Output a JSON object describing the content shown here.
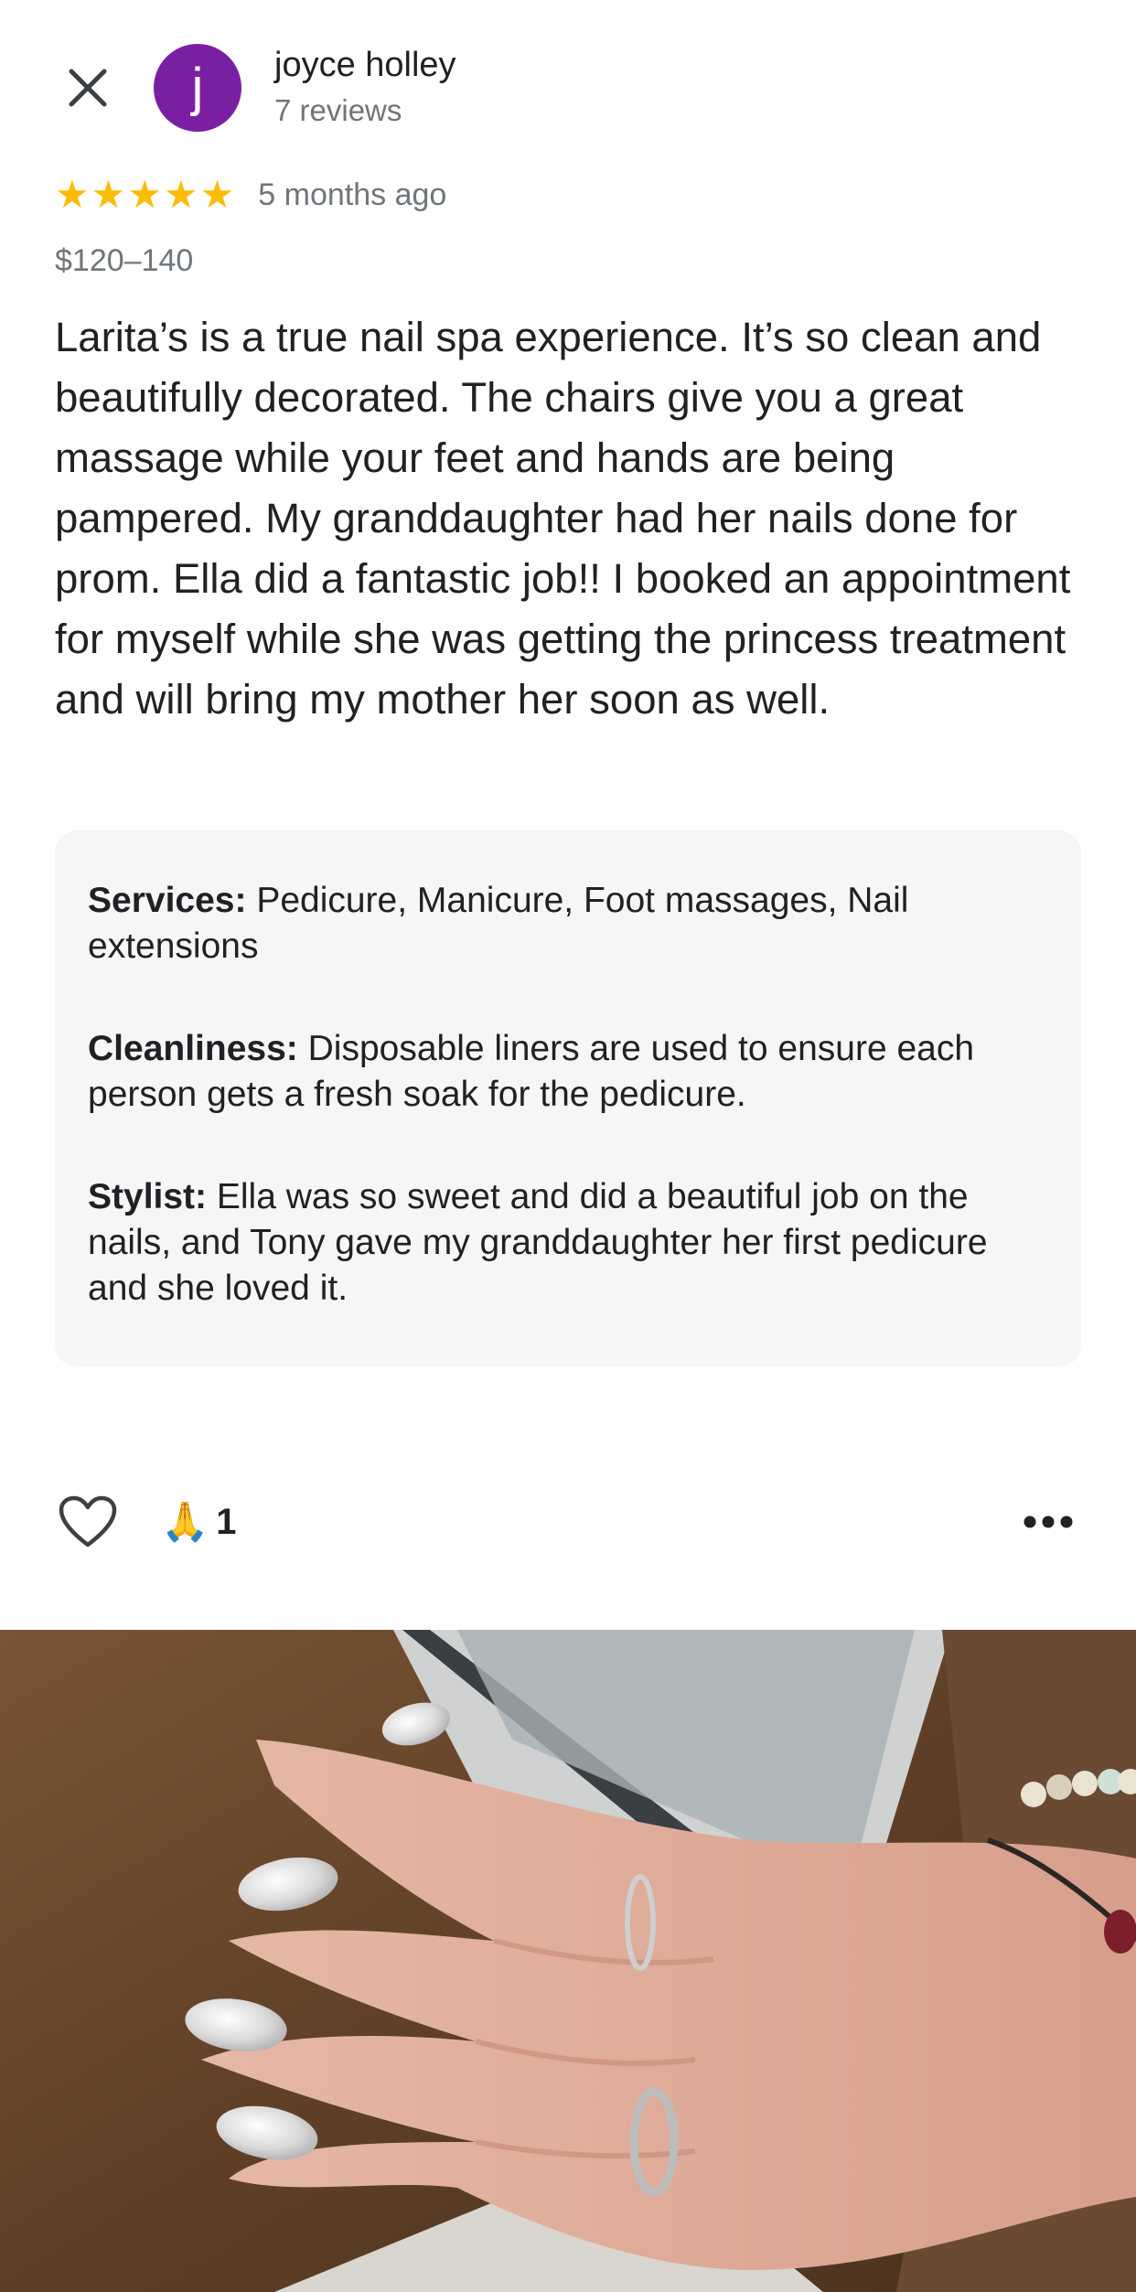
{
  "reviewer": {
    "avatar_letter": "j",
    "avatar_color": "#7b1fa2",
    "name": "joyce holley",
    "review_count": "7 reviews"
  },
  "rating": {
    "stars": 5,
    "star_color": "#fbbc04",
    "time_ago": "5 months ago"
  },
  "price_range": "$120–140",
  "review_text": "Larita’s is a true nail spa experience. It’s so clean and beautifully decorated. The chairs give you a great massage while your feet and hands are being pampered. My granddaughter had her nails done for prom. Ella did a fantastic job!! I booked an appointment for myself while she was getting the princess treatment and will bring my mother her soon as well.",
  "details": [
    {
      "label": "Services:",
      "value": "Pedicure, Manicure, Foot massages, Nail extensions"
    },
    {
      "label": "Cleanliness:",
      "value": "Disposable liners are used to ensure each person gets a fresh soak for the pedicure."
    },
    {
      "label": "Stylist:",
      "value": "Ella was so sweet and did a beautiful job on the nails,  and Tony gave my granddaughter her first pedicure and she loved it."
    }
  ],
  "actions": {
    "like_icon": "heart-outline-icon",
    "reaction_emoji": "🙏",
    "reaction_count": "1",
    "more_icon": "more-horizontal-icon"
  },
  "photo": {
    "subject": "hand-with-glitter-nails-photo"
  },
  "icons": {
    "close": "close-icon"
  }
}
